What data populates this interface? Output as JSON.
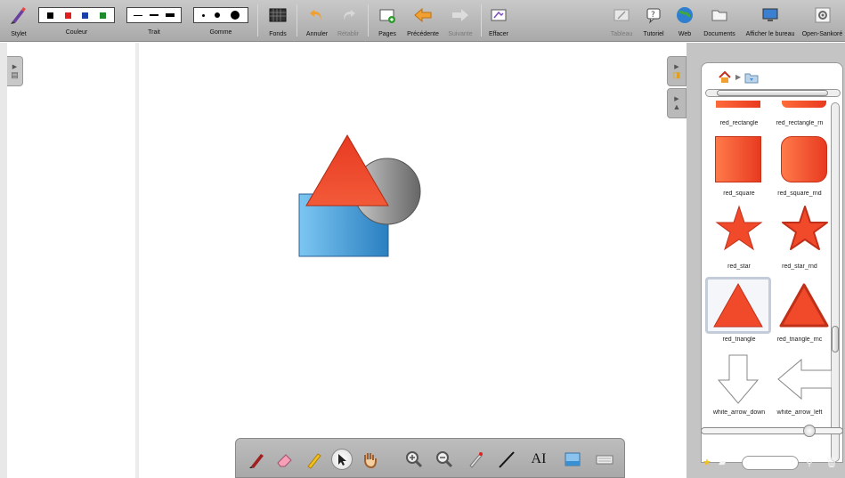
{
  "toolbar": {
    "stylet": "Stylet",
    "couleur": "Couleur",
    "trait": "Trait",
    "gomme": "Gomme",
    "fonds": "Fonds",
    "annuler": "Annuler",
    "retablir": "Rétablir",
    "pages": "Pages",
    "precedente": "Précédente",
    "suivante": "Suivante",
    "effacer": "Effacer",
    "tableau": "Tableau",
    "tutoriel": "Tutoriel",
    "web": "Web",
    "documents": "Documents",
    "afficher_bureau": "Afficher le bureau",
    "open_sankore": "Open-Sankoré"
  },
  "colors": {
    "palette": [
      "#000000",
      "#e02020",
      "#1a3fa8",
      "#1d8a2c"
    ],
    "accent_red": "#f04a2a",
    "accent_blue": "#3a8fd0"
  },
  "library": {
    "items": [
      {
        "name": "red_rectangle",
        "shape": "rectangle"
      },
      {
        "name": "red_rectangle_rn",
        "shape": "rectangle"
      },
      {
        "name": "red_square",
        "shape": "square"
      },
      {
        "name": "red_square_rnd",
        "shape": "square-rounded"
      },
      {
        "name": "red_star",
        "shape": "star"
      },
      {
        "name": "red_star_rnd",
        "shape": "star"
      },
      {
        "name": "red_triangle",
        "shape": "triangle"
      },
      {
        "name": "red_triangle_rnc",
        "shape": "triangle"
      },
      {
        "name": "white_arrow_down",
        "shape": "arrow-down"
      },
      {
        "name": "white_arrow_left",
        "shape": "arrow-left"
      }
    ]
  },
  "bottom_tools": [
    "pen-icon",
    "eraser-icon",
    "highlighter-icon",
    "pointer-icon",
    "hand-icon",
    "zoom-in-icon",
    "zoom-out-icon",
    "laser-pointer-icon",
    "line-icon",
    "text-icon",
    "capture-icon",
    "keyboard-icon"
  ],
  "bottom_tool_text": "AI"
}
